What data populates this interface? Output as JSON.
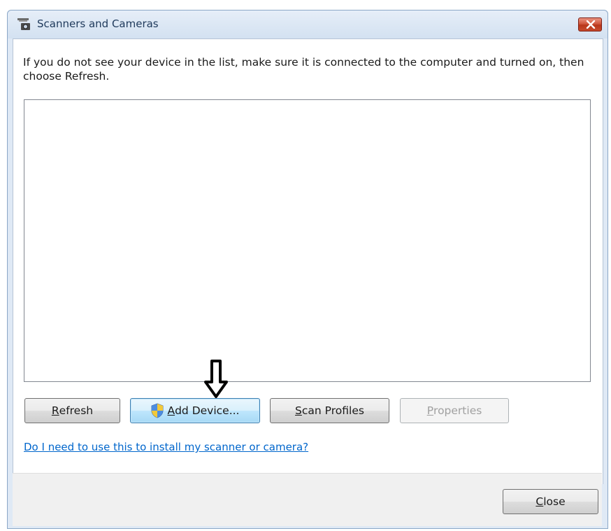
{
  "window": {
    "title": "Scanners and Cameras",
    "icon": "scanner-camera-icon",
    "close_icon": "close-icon"
  },
  "main": {
    "instruction": "If you do not see your device in the list, make sure it is connected to the computer and turned on, then choose Refresh.",
    "device_list": []
  },
  "buttons": {
    "refresh": {
      "mnemonic": "R",
      "rest": "efresh"
    },
    "add_device": {
      "mnemonic": "A",
      "rest": "dd Device...",
      "icon": "uac-shield-icon"
    },
    "scan_profiles": {
      "mnemonic": "S",
      "rest": "can Profiles"
    },
    "properties": {
      "mnemonic": "P",
      "rest": "roperties",
      "enabled": false
    }
  },
  "help_link": "Do I need to use this to install my scanner or camera?",
  "footer": {
    "close": {
      "mnemonic": "C",
      "rest": "lose"
    }
  },
  "annotation": {
    "icon": "down-arrow-icon"
  },
  "colors": {
    "link": "#0066cc",
    "default_button_border": "#3c7fb1",
    "title_close_red": "#c74a2c"
  }
}
